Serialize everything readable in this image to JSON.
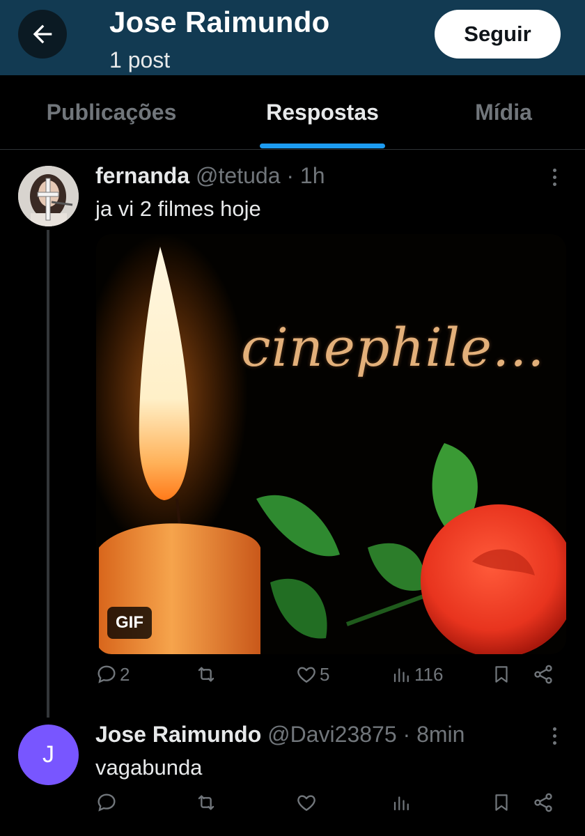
{
  "header": {
    "name": "Jose Raimundo",
    "post_count": "1 post",
    "follow_label": "Seguir"
  },
  "tabs": [
    {
      "label": "Publicações",
      "active": false
    },
    {
      "label": "Respostas",
      "active": true
    },
    {
      "label": "Mídia",
      "active": false
    }
  ],
  "posts": [
    {
      "name": "fernanda",
      "meta": "@tetuda · 1h",
      "text": "ja vi 2 filmes hoje",
      "media": {
        "caption": "cinephile...",
        "badge": "GIF"
      },
      "actions": {
        "replies": "2",
        "reposts": "",
        "likes": "5",
        "views": "116"
      }
    },
    {
      "name": "Jose Raimundo",
      "meta": "@Davi23875 · 8min",
      "text": "vagabunda",
      "avatar_letter": "J",
      "avatar_color": "#7856ff",
      "actions": {
        "replies": "",
        "reposts": "",
        "likes": "",
        "views": ""
      }
    }
  ],
  "colors": {
    "header_bg": "#123a52",
    "accent": "#1d9bf0",
    "muted": "#71767b"
  }
}
